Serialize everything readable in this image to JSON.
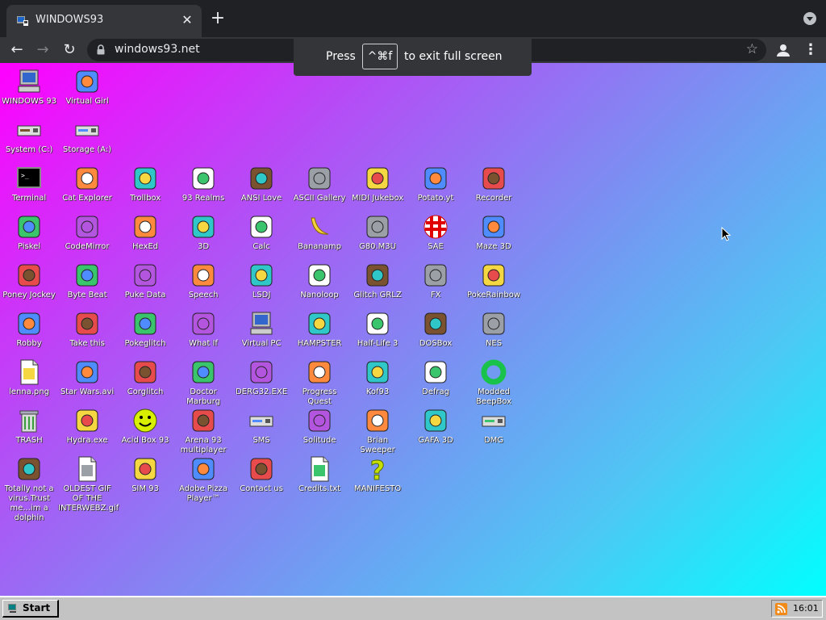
{
  "browser": {
    "tab_title": "WINDOWS93",
    "tab_close": "✕",
    "new_tab": "+",
    "url": "windows93.net",
    "fullscreen_press": "Press",
    "fullscreen_key": "^⌘f",
    "fullscreen_tail": "to exit full screen"
  },
  "desktop": {
    "icons": [
      {
        "label": "WINDOWS 93",
        "icon": "computer-icon"
      },
      {
        "label": "Virtual Girl",
        "icon": "face-icon"
      },
      {
        "label": "System (C:)",
        "icon": "drive-icon"
      },
      {
        "label": "Storage (A:)",
        "icon": "floppy-drive-icon"
      },
      {
        "label": "Terminal",
        "icon": "terminal-icon"
      },
      {
        "label": "Cat Explorer",
        "icon": "globe-cat-icon"
      },
      {
        "label": "Trollbox",
        "icon": "chat-bubble-icon"
      },
      {
        "label": "93 Realms",
        "icon": "realms-icon"
      },
      {
        "label": "ANSI Love",
        "icon": "ansi-icon"
      },
      {
        "label": "ASCII Gallery",
        "icon": "ascii-icon"
      },
      {
        "label": "MIDI Jukebox",
        "icon": "piano-icon"
      },
      {
        "label": "Potato.yt",
        "icon": "potato-icon"
      },
      {
        "label": "Recorder",
        "icon": "microphone-icon"
      },
      {
        "label": "Piskel",
        "icon": "palette-icon"
      },
      {
        "label": "CodeMirror",
        "icon": "codemirror-icon"
      },
      {
        "label": "HexEd",
        "icon": "cube-icon"
      },
      {
        "label": "3D",
        "icon": "teapot-icon"
      },
      {
        "label": "Calc",
        "icon": "calculator-icon"
      },
      {
        "label": "Bananamp",
        "icon": "banana-icon"
      },
      {
        "label": "G80.M3U",
        "icon": "speaker-icon"
      },
      {
        "label": "SAE",
        "icon": "ball-icon"
      },
      {
        "label": "Maze 3D",
        "icon": "maze-icon"
      },
      {
        "label": "Poney Jockey",
        "icon": "pony-icon"
      },
      {
        "label": "Byte Beat",
        "icon": "bytebeat-icon"
      },
      {
        "label": "Puke Data",
        "icon": "pd-icon"
      },
      {
        "label": "Speech",
        "icon": "speech-face-icon"
      },
      {
        "label": "LSDJ",
        "icon": "lsdj-icon"
      },
      {
        "label": "Nanoloop",
        "icon": "waves-icon"
      },
      {
        "label": "Glitch GRLZ",
        "icon": "lips-icon"
      },
      {
        "label": "FX",
        "icon": "atom-icon"
      },
      {
        "label": "PokeRainbow",
        "icon": "characters-icon"
      },
      {
        "label": "Robby",
        "icon": "stick-figure-icon"
      },
      {
        "label": "Take this",
        "icon": "clown-icon"
      },
      {
        "label": "Pokeglitch",
        "icon": "glitch-icon"
      },
      {
        "label": "What If",
        "icon": "whatif-icon"
      },
      {
        "label": "Virtual PC",
        "icon": "virtual-pc-icon"
      },
      {
        "label": "HAMPSTER",
        "icon": "hamster-icon"
      },
      {
        "label": "Half-Life 3",
        "icon": "lambda-icon"
      },
      {
        "label": "DOSBox",
        "icon": "dosbox-icon"
      },
      {
        "label": "NES",
        "icon": "nes-icon"
      },
      {
        "label": "lenna.png",
        "icon": "image-file-icon"
      },
      {
        "label": "Star Wars.avi",
        "icon": "yoda-icon"
      },
      {
        "label": "Corglitch",
        "icon": "corgi-icon"
      },
      {
        "label": "Doctor Marburg",
        "icon": "doctor-icon"
      },
      {
        "label": "DERG32.EXE",
        "icon": "derg-icon"
      },
      {
        "label": "Progress Quest",
        "icon": "swords-icon"
      },
      {
        "label": "Kof93",
        "icon": "fighter-icon"
      },
      {
        "label": "Defrag",
        "icon": "defrag-icon"
      },
      {
        "label": "Modded BeepBox",
        "icon": "ring-icon"
      },
      {
        "label": "TRASH",
        "icon": "trash-icon"
      },
      {
        "label": "Hydra.exe",
        "icon": "hydra-icon"
      },
      {
        "label": "Acid Box 93",
        "icon": "smiley-icon"
      },
      {
        "label": "Arena 93 multiplayer",
        "icon": "arena-cube-icon"
      },
      {
        "label": "SMS",
        "icon": "console-icon"
      },
      {
        "label": "Solitude",
        "icon": "solitude-icon"
      },
      {
        "label": "Brian Sweeper",
        "icon": "mine-icon"
      },
      {
        "label": "GAFA 3D",
        "icon": "doomguy-icon"
      },
      {
        "label": "DMG",
        "icon": "gameboy-icon"
      },
      {
        "label": "Totally not a virus.Trust me...im a dolphin",
        "icon": "dolphin-icon"
      },
      {
        "label": "OLDEST GIF OF THE INTERWEBZ.gif",
        "icon": "gif-file-icon"
      },
      {
        "label": "SIM 93",
        "icon": "book-icon"
      },
      {
        "label": "Adobe Pizza Player™",
        "icon": "pizza-icon"
      },
      {
        "label": "Contact us",
        "icon": "contact-icon"
      },
      {
        "label": "Credits.txt",
        "icon": "text-file-icon"
      },
      {
        "label": "MANIFESTO",
        "icon": "question-mark-icon"
      }
    ]
  },
  "taskbar": {
    "start_label": "Start",
    "clock": "16:01"
  },
  "colors": {
    "desktop_gradient_start": "#ff00ff",
    "desktop_gradient_end": "#00ffff",
    "taskbar": "#c3c3c3"
  }
}
